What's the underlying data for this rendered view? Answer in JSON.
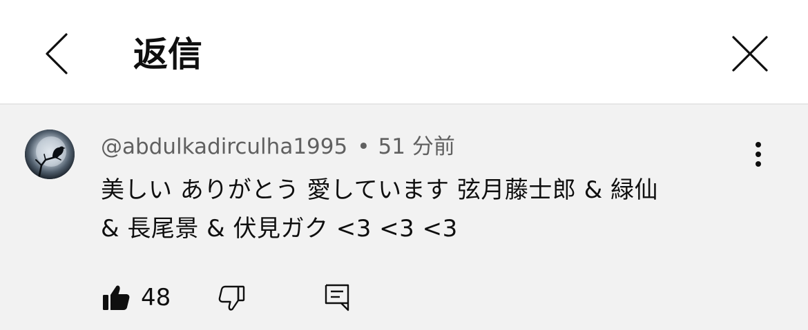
{
  "header": {
    "title": "返信",
    "back_icon": "chevron-left-icon",
    "close_icon": "close-icon"
  },
  "comment": {
    "author": "@abdulkadirculha1995",
    "separator": "•",
    "timestamp": "51 分前",
    "text_line1": "美しい ありがとう 愛しています 弦月藤士郎 & 緑仙",
    "text_line2": "& 長尾景 & 伏見ガク <3 <3 <3",
    "likes": "48",
    "avatar_icon": "moon-crow-avatar",
    "more_icon": "more-vertical-icon",
    "like_icon": "thumbs-up-filled-icon",
    "dislike_icon": "thumbs-down-icon",
    "reply_icon": "reply-comment-icon"
  },
  "colors": {
    "background": "#ffffff",
    "comment_background": "#f2f2f2",
    "text_primary": "#0f0f0f",
    "text_secondary": "#606060"
  }
}
